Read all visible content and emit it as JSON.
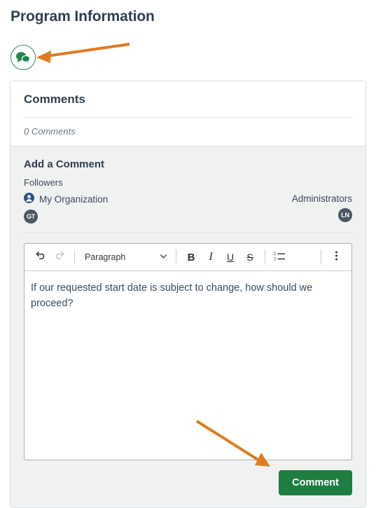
{
  "page": {
    "title": "Program Information"
  },
  "comment_badge": {
    "icon": "chat-bubbles-icon",
    "color": "#2e8b57"
  },
  "card": {
    "title": "Comments",
    "comment_count_label": "0 Comments",
    "add_comment_title": "Add a Comment",
    "followers_label": "Followers",
    "followers": [
      {
        "name": "My Organization",
        "icon": "person-icon",
        "avatar_initials": "GT"
      },
      {
        "name": "Administrators",
        "avatar_initials": "LN"
      }
    ],
    "editor": {
      "toolbar": {
        "undo_label": "undo-icon",
        "redo_label": "redo-icon",
        "block_format": "Paragraph",
        "chevron": "chevron-down-icon",
        "bold": "B",
        "italic": "I",
        "underline": "U",
        "strikethrough": "S",
        "numbered_list": "numbered-list-icon",
        "overflow": "kebab-menu-icon"
      },
      "content": "If our requested start date is subject to change, how should we proceed?"
    },
    "submit_label": "Comment"
  },
  "annotations": {
    "color": "#e07b21",
    "arrow_1_target": "chat-bubbles-icon",
    "arrow_2_target": "Comment"
  }
}
